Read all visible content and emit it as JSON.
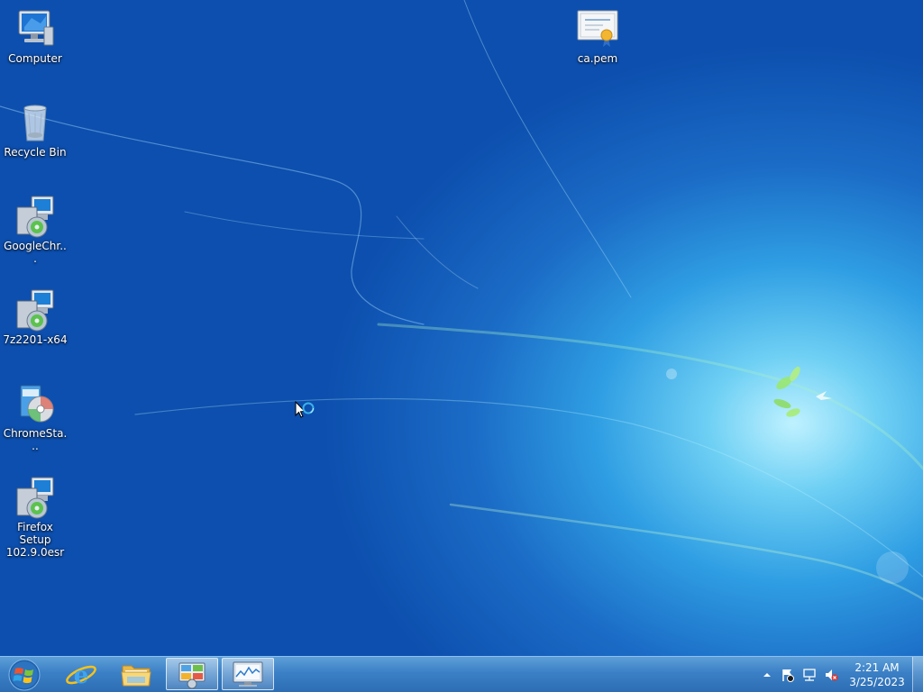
{
  "desktop": {
    "icons": [
      {
        "label": "Computer",
        "icon": "computer-icon"
      },
      {
        "label": "Recycle Bin",
        "icon": "recycle-bin-icon"
      },
      {
        "label": "GoogleChr...",
        "icon": "installer-icon"
      },
      {
        "label": "7z2201-x64",
        "icon": "installer-icon"
      },
      {
        "label": "ChromeSta...",
        "icon": "setup-disc-icon"
      },
      {
        "label": "Firefox Setup 102.9.0esr",
        "icon": "installer-icon"
      },
      {
        "label": "ca.pem",
        "icon": "certificate-icon"
      }
    ]
  },
  "taskbar": {
    "items": [
      {
        "name": "start-button",
        "icon": "windows-logo-icon"
      },
      {
        "name": "internet-explorer",
        "icon": "internet-explorer-icon"
      },
      {
        "name": "windows-explorer",
        "icon": "folder-icon"
      },
      {
        "name": "control-panel",
        "icon": "control-panel-icon",
        "active": true
      },
      {
        "name": "resource-monitor",
        "icon": "monitor-chart-icon",
        "active": true
      }
    ],
    "tray": {
      "icons": [
        "show-hidden-icons-arrow",
        "action-center-flag-icon",
        "network-icon",
        "volume-muted-icon"
      ],
      "time": "2:21 AM",
      "date": "3/25/2023"
    }
  },
  "colors": {
    "taskbar": "#3b80c6",
    "desktop_dark": "#0d4fae",
    "desktop_light": "#6fd0f4"
  }
}
